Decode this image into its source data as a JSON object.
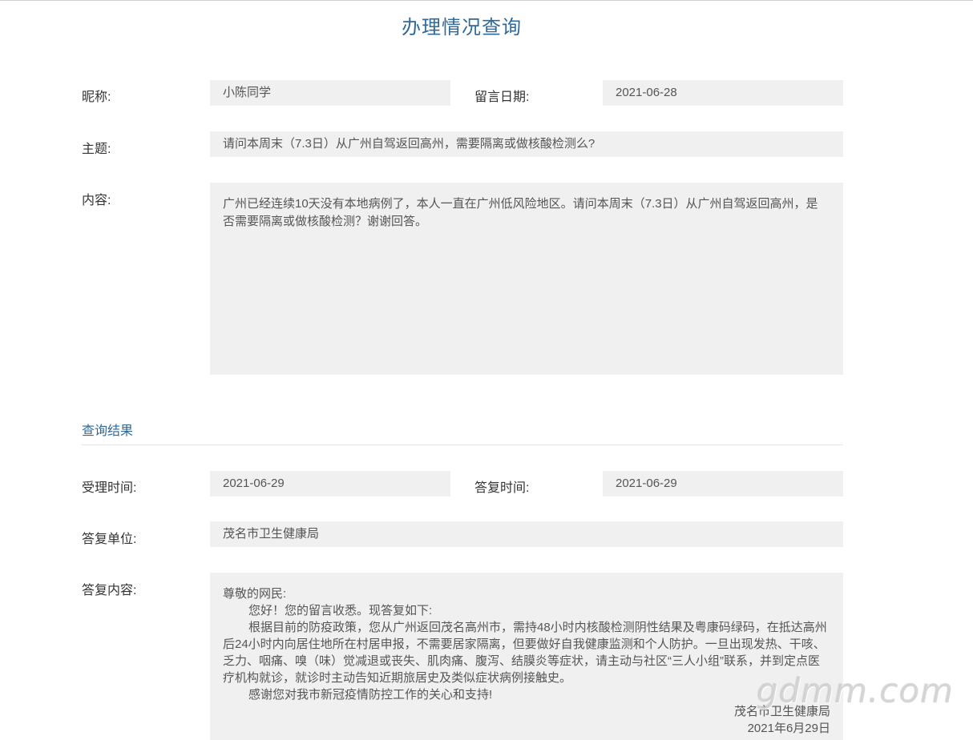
{
  "page_title": "办理情况查询",
  "form": {
    "nickname_label": "昵称:",
    "nickname": "小陈同学",
    "date_label": "留言日期:",
    "date": "2021-06-28",
    "subject_label": "主题:",
    "subject": "请问本周末（7.3日）从广州自驾返回高州，需要隔离或做核酸检测么?",
    "content_label": "内容:",
    "content": "广州已经连续10天没有本地病例了，本人一直在广州低风险地区。请问本周末（7.3日）从广州自驾返回高州，是否需要隔离或做核酸检测？谢谢回答。"
  },
  "result": {
    "section_title": "查询结果",
    "accepted_label": "受理时间:",
    "accepted": "2021-06-29",
    "reply_time_label": "答复时间:",
    "reply_time": "2021-06-29",
    "unit_label": "答复单位:",
    "unit": "茂名市卫生健康局",
    "reply_label": "答复内容:",
    "reply": {
      "greeting": "尊敬的网民:",
      "line1": "您好！您的留言收悉。现答复如下:",
      "line2": "根据目前的防疫政策，您从广州返回茂名高州市，需持48小时内核酸检测阴性结果及粤康码绿码，在抵达高州后24小时内向居住地所在村居申报，不需要居家隔离，但要做好自我健康监测和个人防护。一旦出现发热、干咳、乏力、咽痛、嗅（味）觉减退或丧失、肌肉痛、腹泻、结膜炎等症状，请主动与社区“三人小组”联系，并到定点医疗机构就诊，就诊时主动告知近期旅居史及类似症状病例接触史。",
      "line3": "感谢您对我市新冠疫情防控工作的关心和支持!",
      "signature": "茂名市卫生健康局",
      "sign_date": "2021年6月29日"
    }
  },
  "watermark": "gdmm.com"
}
